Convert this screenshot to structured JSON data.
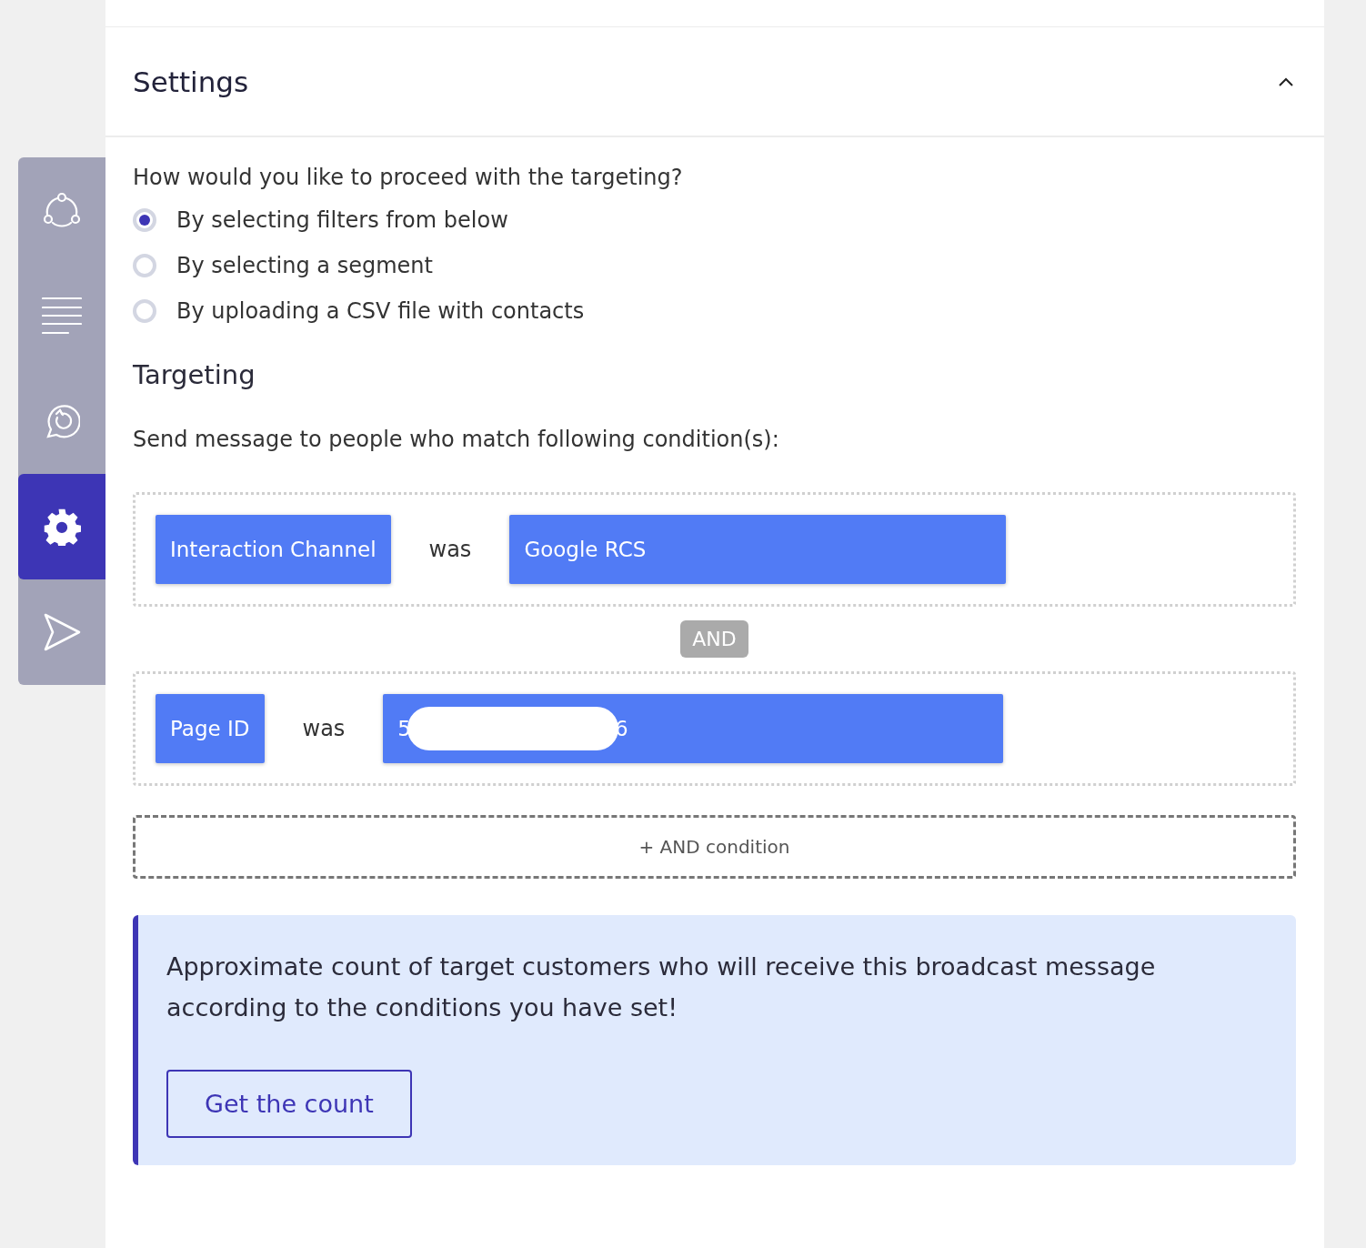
{
  "sidebar": {
    "items": [
      {
        "kind": "share",
        "selected": false
      },
      {
        "kind": "lines",
        "selected": false
      },
      {
        "kind": "chat",
        "selected": false
      },
      {
        "kind": "gear",
        "selected": true
      },
      {
        "kind": "send",
        "selected": false
      }
    ]
  },
  "settings": {
    "title": "Settings",
    "expanded": true,
    "question": "How would you like to proceed with the targeting?",
    "options": [
      {
        "label": "By selecting filters from below",
        "selected": true
      },
      {
        "label": "By selecting a segment",
        "selected": false
      },
      {
        "label": "By uploading a CSV file with contacts",
        "selected": false
      }
    ],
    "targeting_title": "Targeting",
    "targeting_intro": "Send message to people who match following condition(s):",
    "conditions": [
      {
        "field": "Interaction Channel",
        "operator": "was",
        "value": "Google RCS"
      },
      {
        "field": "Page ID",
        "operator": "was",
        "value_start": "5",
        "value_end": "6",
        "redacted": true
      }
    ],
    "joiner": "AND",
    "add_condition": "+ AND condition",
    "count_box": {
      "text": "Approximate count of target customers who will receive this broadcast message according to the conditions you have set!",
      "button": "Get the count"
    }
  }
}
